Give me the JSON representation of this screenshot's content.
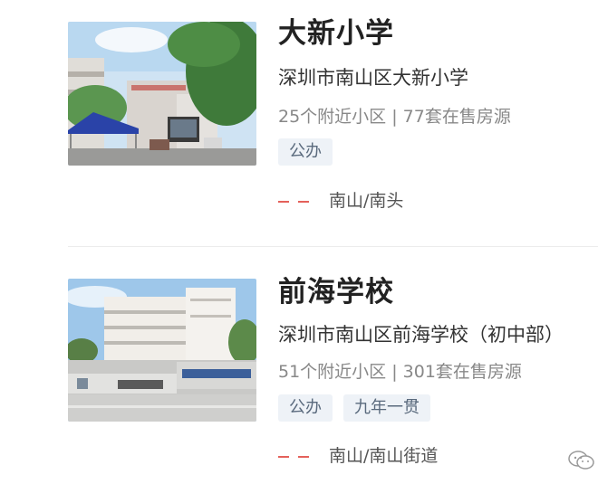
{
  "schools": [
    {
      "name": "大新小学",
      "address": "深圳市南山区大新小学",
      "stats": "25个附近小区 | 77套在售房源",
      "tags": [
        "公办"
      ],
      "location": "南山/南头"
    },
    {
      "name": "前海学校",
      "address": "深圳市南山区前海学校（初中部）",
      "stats": "51个附近小区 | 301套在售房源",
      "tags": [
        "公办",
        "九年一贯"
      ],
      "location": "南山/南山街道"
    }
  ],
  "colors": {
    "accent_dash": "#e4615b",
    "tag_bg": "#eef2f7",
    "tag_text": "#5a6a7d"
  }
}
